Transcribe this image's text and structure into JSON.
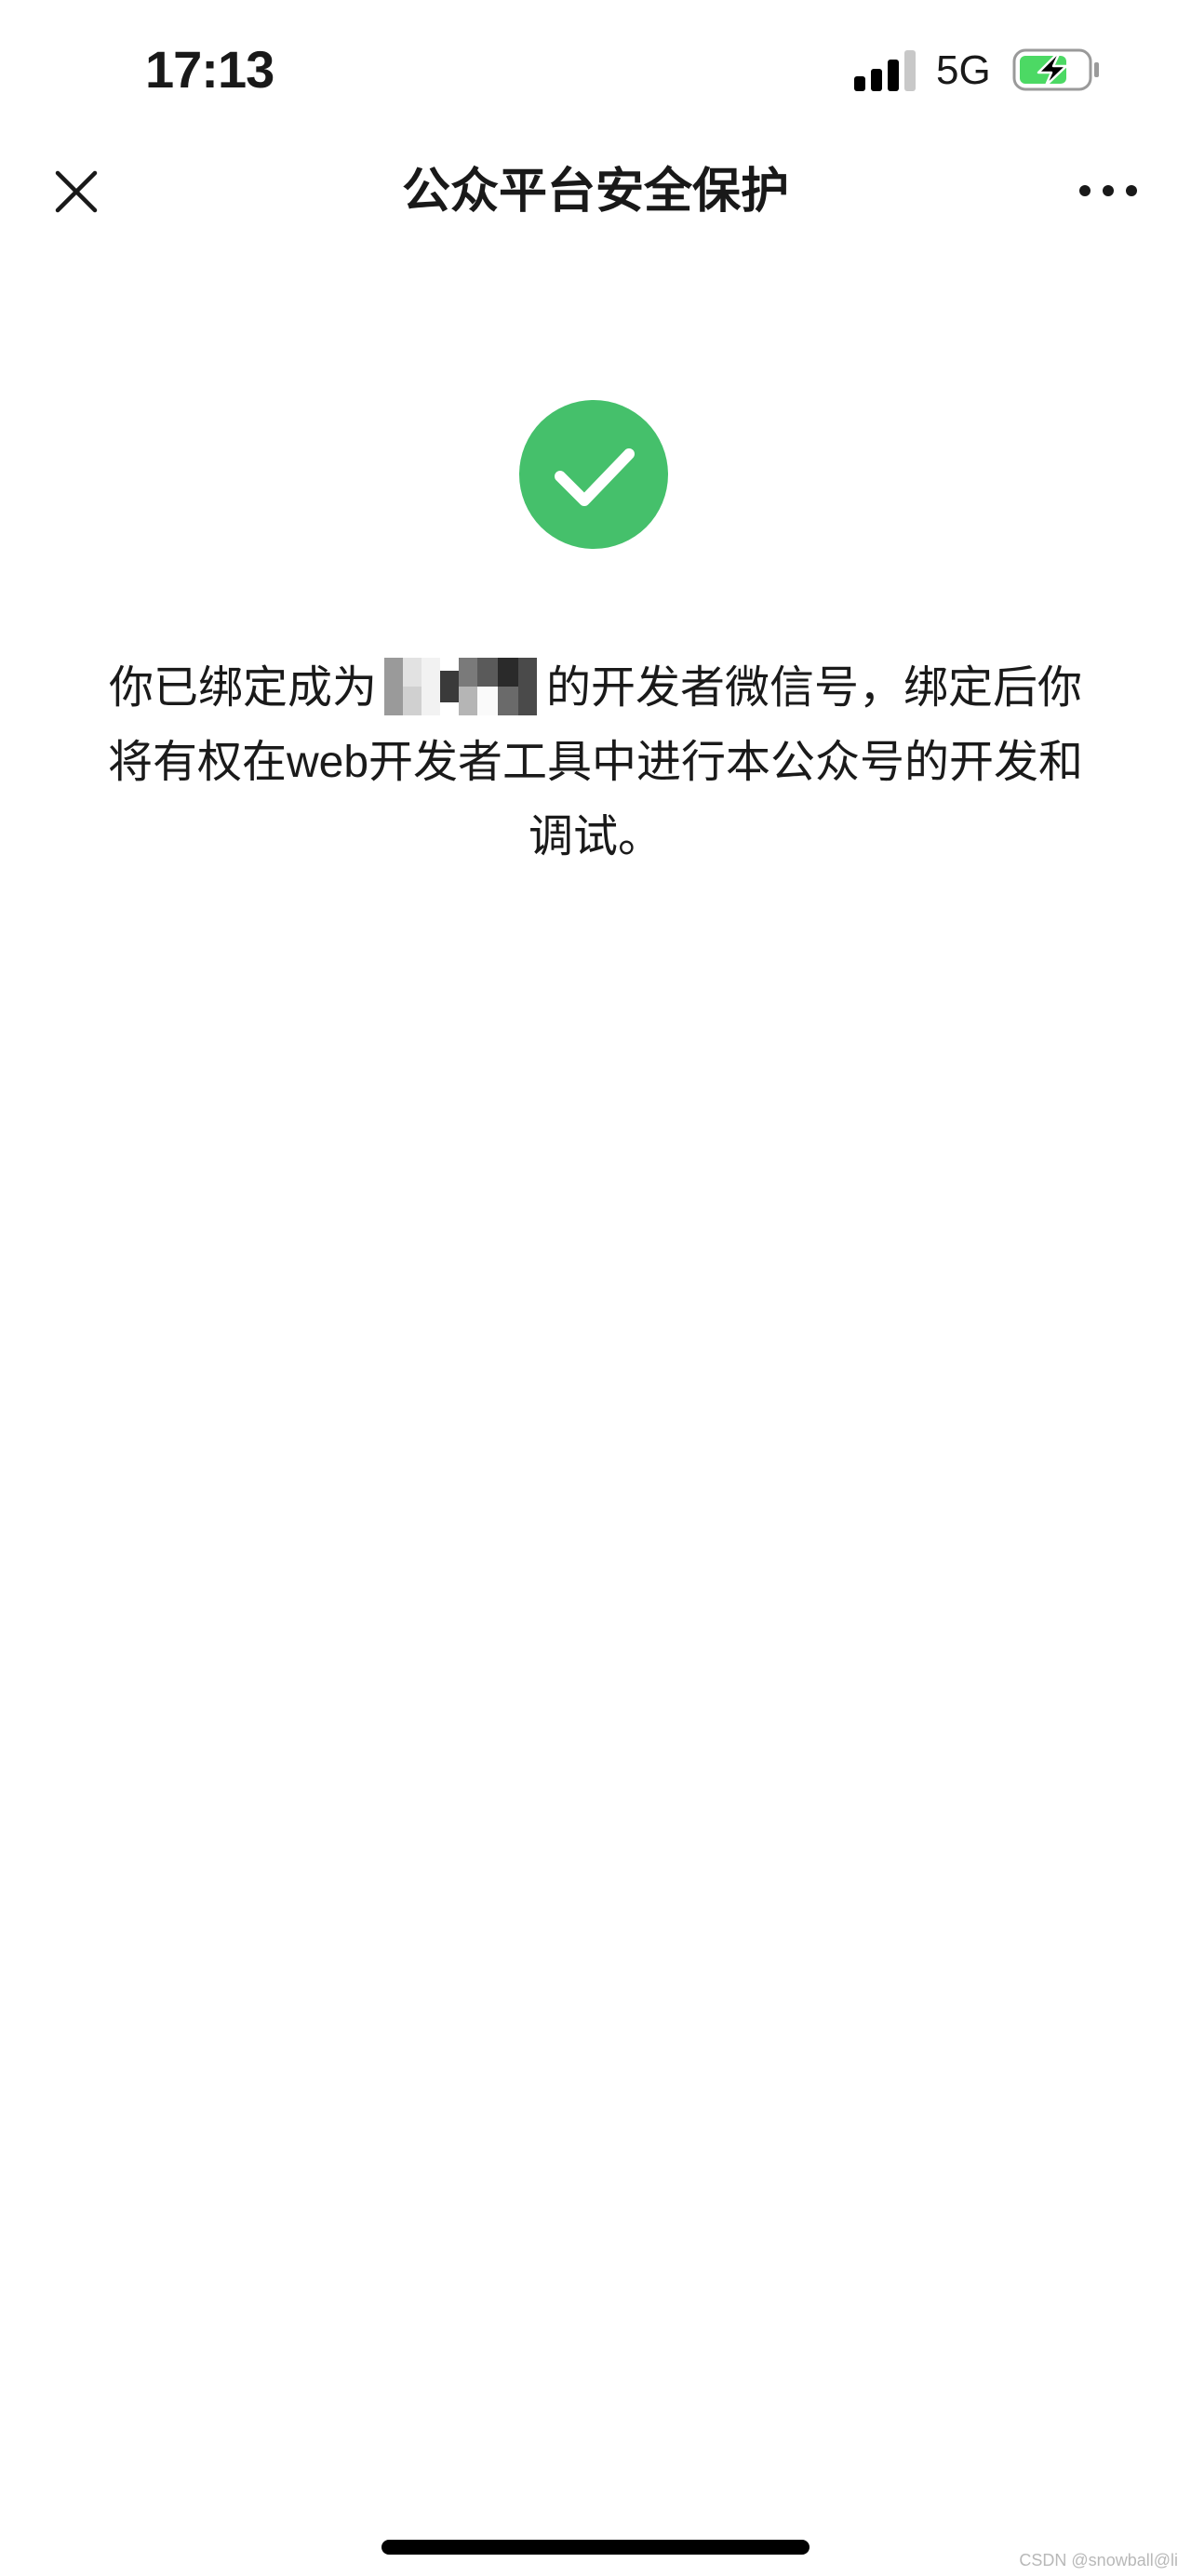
{
  "status_bar": {
    "time": "17:13",
    "network": "5G",
    "signal_icon": "cellular-signal-icon",
    "battery_icon": "battery-charging-icon",
    "battery_color": "#4cd964"
  },
  "nav_bar": {
    "title": "公众平台安全保护",
    "close_icon": "close-icon",
    "more_icon": "more-dots-icon"
  },
  "main": {
    "status_icon": "success-check-icon",
    "accent_color": "#45c06b",
    "message_before": "你已绑定成为",
    "message_after": "的开发者微信号，绑定后你将有权在web开发者工具中进行本公众号的开发和调试。"
  },
  "footer": {
    "watermark": "CSDN @snowball@li"
  }
}
